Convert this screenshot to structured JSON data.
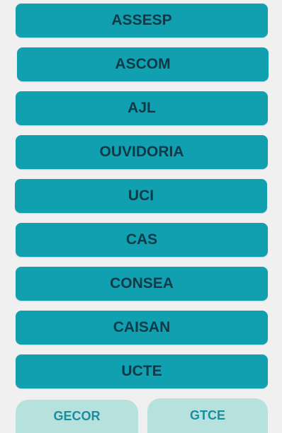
{
  "buttons": [
    {
      "label": "ASSESP"
    },
    {
      "label": "ASCOM"
    },
    {
      "label": "AJL"
    },
    {
      "label": "OUVIDORIA"
    },
    {
      "label": "UCI"
    },
    {
      "label": "CAS"
    },
    {
      "label": "CONSEA"
    },
    {
      "label": "CAISAN"
    },
    {
      "label": "UCTE"
    }
  ],
  "tabs": [
    {
      "label": "GECOR"
    },
    {
      "label": "GTCE"
    }
  ],
  "colors": {
    "button_bg": "#10a0b0",
    "button_text": "#0c3a48",
    "tab_bg": "#b7e1dc",
    "tab_text": "#1a8ea0",
    "page_bg": "#f0f0f0"
  }
}
